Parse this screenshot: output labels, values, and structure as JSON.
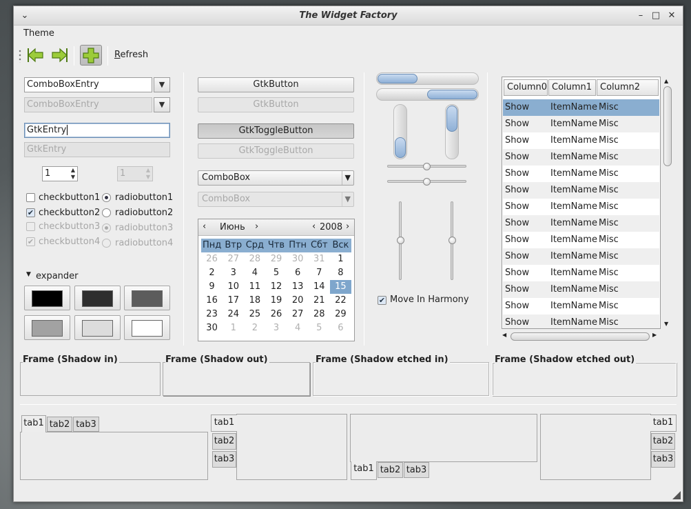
{
  "window": {
    "title": "The Widget Factory"
  },
  "menubar": {
    "theme": "Theme"
  },
  "toolbar": {
    "refresh_label": "Refresh",
    "refresh_mnemonic": "R",
    "refresh_rest": "efresh"
  },
  "left": {
    "combo_entry": "ComboBoxEntry",
    "combo_entry_disabled": "ComboBoxEntry",
    "entry": "GtkEntry",
    "entry_disabled": "GtkEntry",
    "spin1": "1",
    "spin2": "1",
    "checks": [
      {
        "label": "checkbutton1",
        "checked": false
      },
      {
        "label": "checkbutton2",
        "checked": true
      },
      {
        "label": "checkbutton3",
        "checked": false
      },
      {
        "label": "checkbutton4",
        "checked": true
      }
    ],
    "radios": [
      {
        "label": "radiobutton1",
        "on": true
      },
      {
        "label": "radiobutton2",
        "on": false
      },
      {
        "label": "radiobutton3",
        "on": true
      },
      {
        "label": "radiobutton4",
        "on": false
      }
    ],
    "expander": "expander",
    "swatch_colors": [
      "#000000",
      "#2e2e2e",
      "#5c5c5c",
      "#a2a2a2",
      "#dcdcdc",
      "#ffffff"
    ]
  },
  "middle": {
    "button": "GtkButton",
    "button_disabled": "GtkButton",
    "toggle": "GtkToggleButton",
    "toggle_disabled": "GtkToggleButton",
    "combo": "ComboBox",
    "combo_disabled": "ComboBox",
    "calendar": {
      "month": "Июнь",
      "year": "2008",
      "weekdays": [
        "Пнд",
        "Втр",
        "Срд",
        "Чтв",
        "Птн",
        "Сбт",
        "Вск"
      ],
      "rows": [
        [
          "26",
          "27",
          "28",
          "29",
          "30",
          "31",
          "1"
        ],
        [
          "2",
          "3",
          "4",
          "5",
          "6",
          "7",
          "8"
        ],
        [
          "9",
          "10",
          "11",
          "12",
          "13",
          "14",
          "15"
        ],
        [
          "16",
          "17",
          "18",
          "19",
          "20",
          "21",
          "22"
        ],
        [
          "23",
          "24",
          "25",
          "26",
          "27",
          "28",
          "29"
        ],
        [
          "30",
          "1",
          "2",
          "3",
          "4",
          "5",
          "6"
        ]
      ],
      "selected": "15"
    }
  },
  "right": {
    "move_in_harmony": "Move In Harmony",
    "progress_h1": 0.4,
    "progress_h2": 0.5,
    "progress_v1": 0.4,
    "progress_v2": 0.5,
    "hscale1": 0.5,
    "hscale2": 0.5,
    "vscale1": 0.5,
    "vscale2": 0.5
  },
  "tree": {
    "columns": [
      "Column0",
      "Column1",
      "Column2"
    ],
    "rows": [
      [
        "Show",
        "ItemName",
        "Misc"
      ],
      [
        "Show",
        "ItemName",
        "Misc"
      ],
      [
        "Show",
        "ItemName",
        "Misc"
      ],
      [
        "Show",
        "ItemName",
        "Misc"
      ],
      [
        "Show",
        "ItemName",
        "Misc"
      ],
      [
        "Show",
        "ItemName",
        "Misc"
      ],
      [
        "Show",
        "ItemName",
        "Misc"
      ],
      [
        "Show",
        "ItemName",
        "Misc"
      ],
      [
        "Show",
        "ItemName",
        "Misc"
      ],
      [
        "Show",
        "ItemName",
        "Misc"
      ],
      [
        "Show",
        "ItemName",
        "Misc"
      ],
      [
        "Show",
        "ItemName",
        "Misc"
      ],
      [
        "Show",
        "ItemName",
        "Misc"
      ],
      [
        "Show",
        "ItemName",
        "Misc"
      ]
    ]
  },
  "frames": [
    "Frame (Shadow in)",
    "Frame (Shadow out)",
    "Frame (Shadow etched in)",
    "Frame (Shadow etched out)"
  ],
  "tabs": [
    "tab1",
    "tab2",
    "tab3"
  ],
  "colors": {
    "selection": "#8aaed0",
    "accent": "#7ea6cc"
  }
}
